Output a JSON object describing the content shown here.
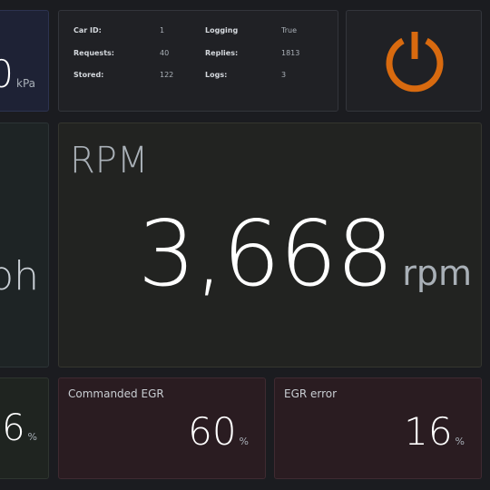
{
  "pressure": {
    "value": "0",
    "unit": "kPa"
  },
  "info": {
    "rows": [
      {
        "label": "Car ID:",
        "value": "1",
        "label2": "Logging",
        "value2": "True"
      },
      {
        "label": "Requests:",
        "value": "40",
        "label2": "Replies:",
        "value2": "1813"
      },
      {
        "label": "Stored:",
        "value": "122",
        "label2": "Logs:",
        "value2": "3"
      }
    ]
  },
  "power": {
    "icon": "power-icon",
    "color": "#d86a0f"
  },
  "speed": {
    "value": "ph"
  },
  "rpm": {
    "title": "RPM",
    "value": "3,668",
    "unit": "rpm"
  },
  "left3": {
    "value": "6",
    "unit": "%"
  },
  "egr_commanded": {
    "title": "Commanded EGR",
    "value": "60",
    "unit": "%"
  },
  "egr_error": {
    "title": "EGR error",
    "value": "16",
    "unit": "%"
  }
}
